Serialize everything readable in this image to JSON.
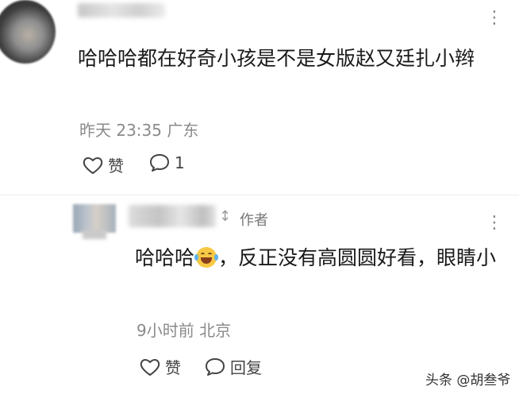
{
  "comment": {
    "text": "哈哈哈都在好奇小孩是不是女版赵又廷扎小辫",
    "time": "昨天 23:35",
    "location": "广东",
    "like_label": "赞",
    "reply_count": "1",
    "more_icon": "more-icon"
  },
  "reply": {
    "author_badge": "作者",
    "text_before_emoji": "哈哈哈",
    "emoji": "laughing-tears-emoji",
    "text_after_emoji": "，反正没有高圆圆好看，眼睛小",
    "time": "9小时前",
    "location": "北京",
    "like_label": "赞",
    "reply_label": "回复",
    "more_icon": "more-icon"
  },
  "watermark": "头条 @胡叁爷"
}
